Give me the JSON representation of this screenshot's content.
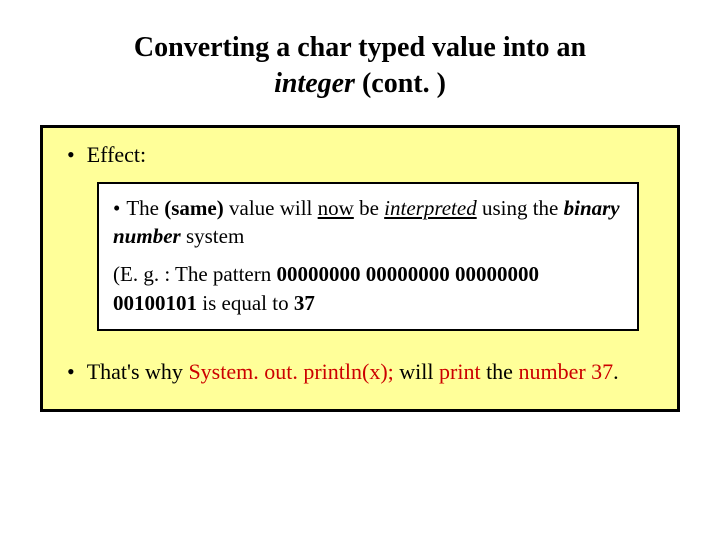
{
  "title": {
    "line1": "Converting a char typed value into an",
    "line2_italic": "integer",
    "line2_rest": " (cont. )"
  },
  "effect": {
    "label": "Effect:"
  },
  "inner": {
    "lead": "The ",
    "same": "(same)",
    "mid1": " value will ",
    "now": "now",
    "mid2": " be ",
    "interpreted": "interpreted",
    "mid3": " using the ",
    "binary_number": "binary number",
    "tail": " system",
    "eg_lead": "(E. g. : The pattern ",
    "bits": "00000000 00000000 00000000 00100101",
    "eg_mid": " is equal to ",
    "thirtyseven": "37"
  },
  "bullet2": {
    "lead": "That's why ",
    "code": "System. out. println(x);",
    "mid": " will ",
    "print": "print",
    "mid2": " the ",
    "number_word": "number 37",
    "tail": "."
  }
}
